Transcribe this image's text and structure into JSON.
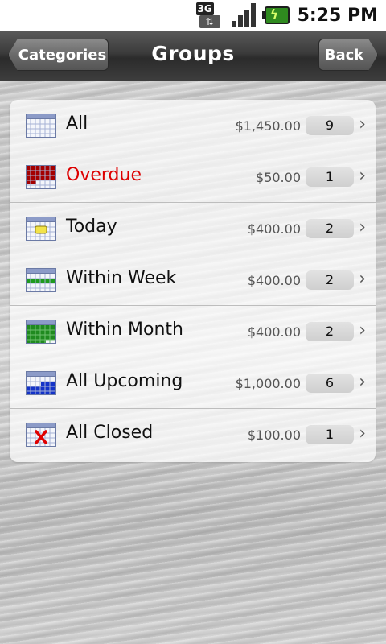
{
  "status_bar": {
    "network": "3G",
    "network_arrows": "⇅",
    "time": "5:25 PM"
  },
  "header": {
    "title": "Groups",
    "left_button": "Categories",
    "right_button": "Back"
  },
  "groups": [
    {
      "label": "All",
      "amount": "$1,450.00",
      "count": "9",
      "icon": "calendar-all-icon"
    },
    {
      "label": "Overdue",
      "amount": "$50.00",
      "count": "1",
      "icon": "calendar-overdue-icon"
    },
    {
      "label": "Today",
      "amount": "$400.00",
      "count": "2",
      "icon": "calendar-today-icon"
    },
    {
      "label": "Within Week",
      "amount": "$400.00",
      "count": "2",
      "icon": "calendar-week-icon"
    },
    {
      "label": "Within Month",
      "amount": "$400.00",
      "count": "2",
      "icon": "calendar-month-icon"
    },
    {
      "label": "All Upcoming",
      "amount": "$1,000.00",
      "count": "6",
      "icon": "calendar-upcoming-icon"
    },
    {
      "label": "All Closed",
      "amount": "$100.00",
      "count": "1",
      "icon": "calendar-closed-icon"
    }
  ],
  "colors": {
    "overdue_text": "#dd0000",
    "overdue_fill": "#a40000",
    "today_fill": "#f2e34a",
    "week_fill": "#1f9a1f",
    "month_fill": "#1f8a1f",
    "upcoming_fill": "#1433c8",
    "closed_mark": "#e00000"
  }
}
